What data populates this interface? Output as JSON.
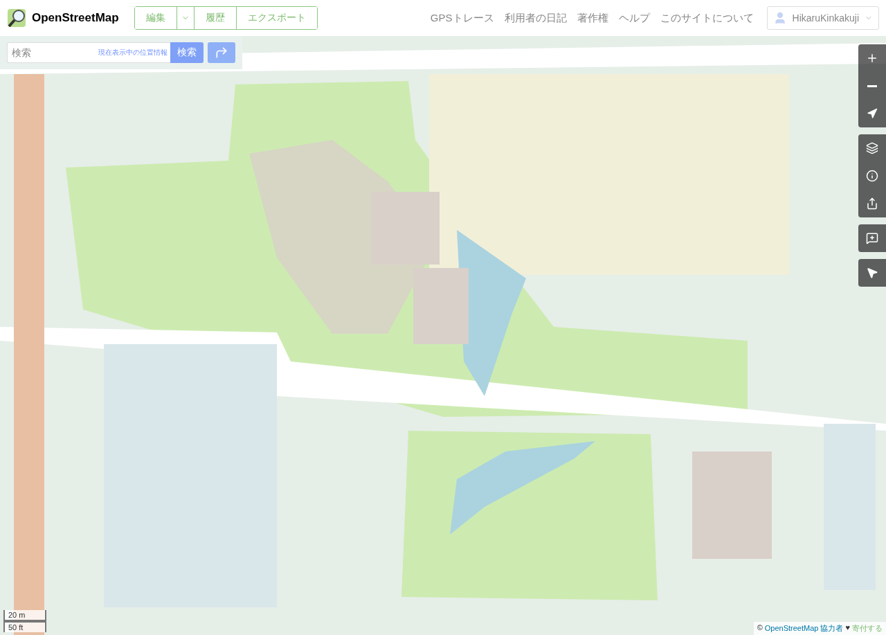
{
  "logo": {
    "title": "OpenStreetMap"
  },
  "edit_group": {
    "edit": "編集",
    "history": "履歴",
    "export": "エクスポート"
  },
  "nav_links": [
    "GPSトレース",
    "利用者の日記",
    "著作権",
    "ヘルプ",
    "このサイトについて"
  ],
  "user": {
    "name": "HikaruKinkakuji"
  },
  "search": {
    "placeholder": "検索",
    "location_link": "現在表示中の位置情報",
    "button": "検索"
  },
  "scale": {
    "metric": "20 m",
    "imperial": "50 ft"
  },
  "attribution": {
    "copyright": "©",
    "link": "OpenStreetMap 協力者",
    "heart": "♥",
    "donate": "寄付する"
  }
}
